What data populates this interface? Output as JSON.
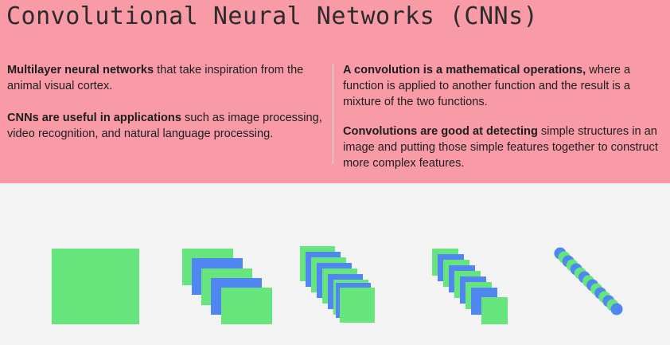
{
  "title": "Convolutional Neural Networks (CNNs)",
  "left_column": [
    {
      "bold": "Multilayer neural networks",
      "rest": " that take inspiration from the animal visual cortex."
    },
    {
      "bold": "CNNs are useful in applications",
      "rest": " such as image processing, video recognition, and natural language processing."
    }
  ],
  "right_column": [
    {
      "bold": "A convolution is a mathematical operations,",
      "rest": " where a function is applied to another function and the result is a mixture of the two functions."
    },
    {
      "bold": "Convolutions are good at detecting",
      "rest": " simple structures in an image and putting those simple features together to construct more complex features."
    }
  ],
  "colors": {
    "header_bg": "#f99aa7",
    "green": "#67e57d",
    "blue": "#4f86f2",
    "body_bg": "#f3f3f3"
  },
  "diagram": {
    "stages": [
      {
        "name": "input-image",
        "layers": 1
      },
      {
        "name": "feature-maps-1",
        "layers": 5
      },
      {
        "name": "feature-maps-2",
        "layers": 9
      },
      {
        "name": "feature-maps-3",
        "layers": 9
      },
      {
        "name": "flattened-vector",
        "nodes": 15
      }
    ]
  }
}
